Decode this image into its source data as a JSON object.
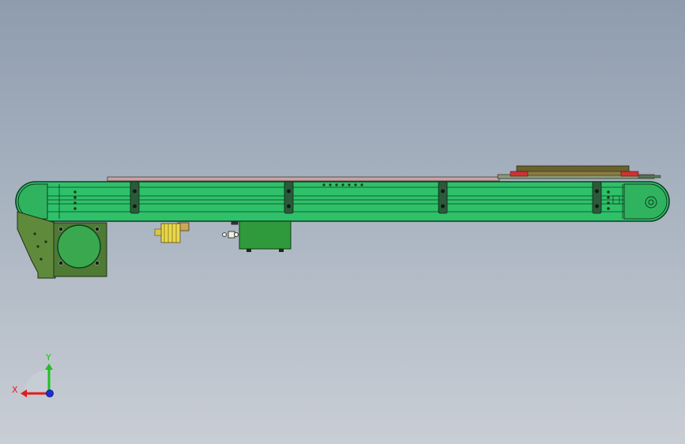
{
  "scene": {
    "background_top": "#8f9cae",
    "background_bottom": "#c9ced5",
    "frame_color": "#2ec16a",
    "frame_dark": "#1f8c4a",
    "belt_color": "#caa0a0",
    "motor_color": "#3aa84f",
    "bracket_color": "#5f8a3b",
    "sensor_color": "#e9d94a",
    "box_color": "#2f9a3c"
  },
  "triad": {
    "x_label": "X",
    "y_label": "Y",
    "x_color": "#e31b1b",
    "y_color": "#20c020",
    "z_color": "#1a2fd6"
  }
}
